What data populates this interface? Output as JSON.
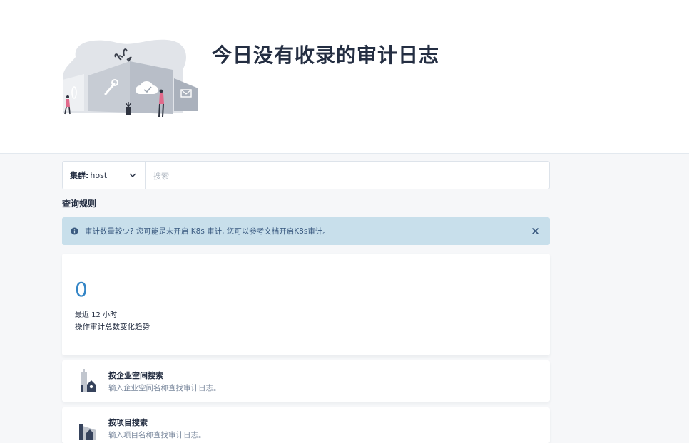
{
  "hero": {
    "title": "今日没有收录的审计日志"
  },
  "search": {
    "cluster_label": "集群:",
    "cluster_value": "host",
    "placeholder": "搜索"
  },
  "rules": {
    "title": "查询规则"
  },
  "alert": {
    "text": "审计数量较少? 您可能是未开启 K8s 审计, 您可以参考文档开启K8s审计。"
  },
  "stats": {
    "count": "0",
    "period": "最近 12 小时",
    "description": "操作审计总数变化趋势"
  },
  "entries": [
    {
      "title": "按企业空间搜索",
      "description": "输入企业空间名称查找审计日志。"
    },
    {
      "title": "按项目搜索",
      "description": "输入项目名称查找审计日志。"
    }
  ],
  "colors": {
    "accent": "#3385c6",
    "alert_bg": "#c8dfeb",
    "alert_text": "#3a5a80",
    "text_primary": "#242e42",
    "text_secondary": "#79879c"
  }
}
